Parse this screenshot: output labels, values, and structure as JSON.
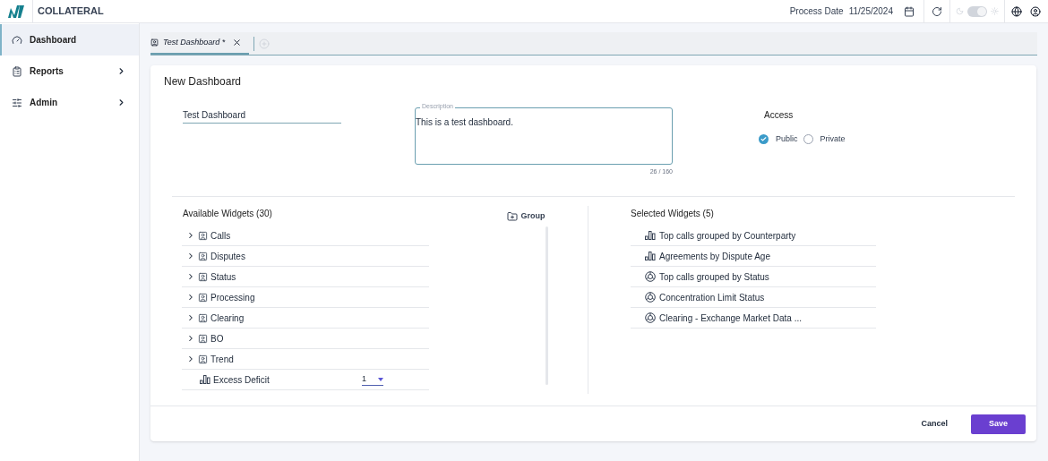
{
  "header": {
    "app_name": "COLLATERAL",
    "process_date_label": "Process Date",
    "process_date": "11/25/2024",
    "theme_toggle": {
      "on": true,
      "disabled": true
    }
  },
  "sidebar": {
    "items": [
      {
        "label": "Dashboard",
        "selected": true,
        "expandable": false
      },
      {
        "label": "Reports",
        "selected": false,
        "expandable": true
      },
      {
        "label": "Admin",
        "selected": false,
        "expandable": true
      }
    ]
  },
  "tabs": [
    {
      "label": "Test Dashboard *",
      "selected": true
    }
  ],
  "form": {
    "title": "New Dashboard",
    "name_value": "Test Dashboard",
    "description_label": "Description",
    "description_value": "This is a test dashboard.",
    "description_count": "26 / 160",
    "access": {
      "label": "Access",
      "options": [
        {
          "label": "Public",
          "selected": true
        },
        {
          "label": "Private",
          "selected": false
        }
      ]
    }
  },
  "available": {
    "title": "Available Widgets (30)",
    "group_button": "Group",
    "items": [
      {
        "kind": "group",
        "label": "Calls",
        "expanded": false
      },
      {
        "kind": "group",
        "label": "Disputes",
        "expanded": false
      },
      {
        "kind": "group",
        "label": "Status",
        "expanded": false
      },
      {
        "kind": "group",
        "label": "Processing",
        "expanded": false
      },
      {
        "kind": "group",
        "label": "Clearing",
        "expanded": false
      },
      {
        "kind": "group",
        "label": "BO",
        "expanded": false
      },
      {
        "kind": "group",
        "label": "Trend",
        "expanded": false
      },
      {
        "kind": "bar_chart",
        "label": "Excess Deficit",
        "count": "1"
      }
    ]
  },
  "selected": {
    "title": "Selected Widgets (5)",
    "items": [
      {
        "kind": "bar_chart",
        "label": "Top calls grouped by Counterparty"
      },
      {
        "kind": "bar_chart",
        "label": "Agreements by Dispute Age"
      },
      {
        "kind": "pie_chart",
        "label": "Top calls grouped by Status"
      },
      {
        "kind": "pie_chart",
        "label": "Concentration Limit Status"
      },
      {
        "kind": "pie_chart",
        "label": "Clearing - Exchange Market Data ..."
      }
    ]
  },
  "buttons": [
    {
      "label": "Cancel",
      "kind": "secondary"
    },
    {
      "label": "Save",
      "kind": "primary"
    }
  ]
}
